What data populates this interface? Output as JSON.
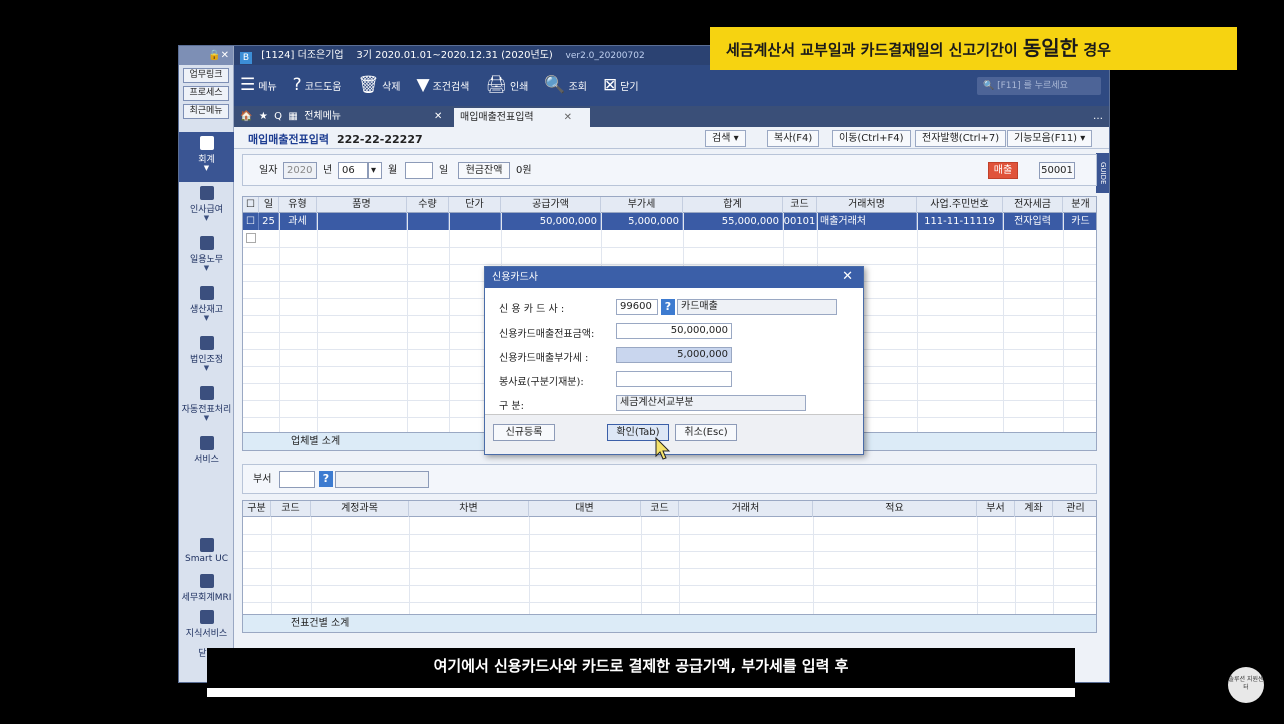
{
  "banner": {
    "text_pre": "세금계산서 교부일과 카드결재일의 신고기간이 ",
    "text_em": "동일한",
    "text_post": " 경우"
  },
  "subtitle": "여기에서 신용카드사와 카드로 결제한 공급가액, 부가세를 입력 후",
  "channel": {
    "name": "솔루션 지원센터"
  },
  "sidebar": {
    "top_icons": "🔒✕",
    "buttons": [
      "업무링크",
      "프로세스",
      "최근메뉴"
    ],
    "items": [
      {
        "label": "회계",
        "icon": "calculator-icon"
      },
      {
        "label": "인사급여",
        "icon": "people-icon"
      },
      {
        "label": "일용노무",
        "icon": "worker-icon"
      },
      {
        "label": "생산재고",
        "icon": "factory-icon"
      },
      {
        "label": "법인조정",
        "icon": "building-icon"
      },
      {
        "label": "자동전표처리",
        "icon": "auto-voucher-icon"
      },
      {
        "label": "서비스",
        "icon": "monitor-icon"
      }
    ],
    "bottom": [
      {
        "label": "Smart UC",
        "icon": "uc-icon"
      },
      {
        "label": "세무회계MRI",
        "icon": "chart-icon"
      },
      {
        "label": "지식서비스",
        "icon": "book-icon"
      },
      {
        "label": "닫기",
        "icon": "close-icon"
      }
    ]
  },
  "titlebar": {
    "company": "[1124] 더조은기업",
    "period": "3기 2020.01.01~2020.12.31 (2020년도)",
    "version": "ver2.0_20200702"
  },
  "toolbar": {
    "items": [
      {
        "label": "메뉴",
        "glyph": "☰"
      },
      {
        "label": "코드도움",
        "glyph": "?"
      },
      {
        "label": "삭제",
        "glyph": "🗑"
      },
      {
        "label": "조건검색",
        "glyph": "▼"
      },
      {
        "label": "인쇄",
        "glyph": "🖨"
      },
      {
        "label": "조회",
        "glyph": "🔍"
      },
      {
        "label": "닫기",
        "glyph": "⊠"
      }
    ],
    "search_placeholder": "[F11] 를 누르세요"
  },
  "tabs": {
    "all_menu": "전체메뉴",
    "active": "매입매출전표입력"
  },
  "form": {
    "title": "매입매출전표입력",
    "code": "222-22-22227",
    "buttons": [
      "검색 ▾",
      "복사(F4)",
      "이동(Ctrl+F4)",
      "전자발행(Ctrl+7)",
      "기능모음(F11) ▾"
    ],
    "guide": "GUIDE"
  },
  "daterow": {
    "label_date": "일자",
    "year": "2020",
    "label_year": "년",
    "month": "06",
    "label_month": "월",
    "label_day": "일",
    "cash_btn": "현금잔액",
    "cash_value": "0원",
    "type_badge": "매출",
    "code_value": "50001"
  },
  "grid1": {
    "headers": [
      "일",
      "유형",
      "품명",
      "수량",
      "단가",
      "공급가액",
      "부가세",
      "합계",
      "코드",
      "거래처명",
      "사업.주민번호",
      "전자세금",
      "분개"
    ],
    "row": [
      "25",
      "과세",
      "",
      "",
      "",
      "50,000,000",
      "5,000,000",
      "55,000,000",
      "00101",
      "매출거래처",
      "111-11-11119",
      "전자입력",
      "카드"
    ],
    "subtotal": "업체별 소계"
  },
  "deptrow": {
    "label": "부서"
  },
  "grid2": {
    "headers": [
      "구분",
      "코드",
      "계정과목",
      "차변",
      "대변",
      "코드",
      "거래처",
      "적요",
      "부서",
      "계좌",
      "관리"
    ],
    "subtotal": "전표건별 소계"
  },
  "dialog": {
    "title": "신용카드사",
    "lab_card": "신 용 카 드 사 :",
    "card_code": "99600",
    "card_name": "카드매출",
    "lab_amount": "신용카드매출전표금액:",
    "amount": "50,000,000",
    "lab_vat": "신용카드매출부가세 :",
    "vat": "5,000,000",
    "lab_service": "봉사료(구분기재분):",
    "service": "",
    "lab_type": "구              분:",
    "type": "세금계산서교부분",
    "btn_new": "신규등록",
    "btn_ok": "확인(Tab)",
    "btn_cancel": "취소(Esc)"
  }
}
